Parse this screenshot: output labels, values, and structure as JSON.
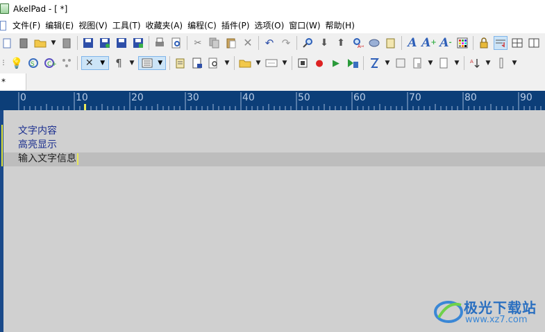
{
  "window": {
    "title": "AkelPad - [ *]"
  },
  "menu": {
    "items": [
      "文件(F)",
      "编辑(E)",
      "视图(V)",
      "工具(T)",
      "收藏夹(A)",
      "编程(C)",
      "插件(P)",
      "选项(O)",
      "窗口(W)",
      "帮助(H)"
    ]
  },
  "tabs": [
    {
      "label": "*"
    }
  ],
  "ruler": {
    "labels": [
      "0",
      "10",
      "20",
      "30",
      "40",
      "50",
      "60",
      "70",
      "80",
      "90"
    ]
  },
  "editor": {
    "lines": [
      "文字内容",
      "高亮显示",
      "输入文字信息"
    ]
  },
  "watermark": {
    "name": "极光下载站",
    "url": "www.xz7.com"
  },
  "colors": {
    "ruler_bg": "#0c3e78",
    "editor_bg": "#d0d0d0",
    "highlight_text": "#1c2f8f",
    "current_line": "#bdbdbd"
  }
}
